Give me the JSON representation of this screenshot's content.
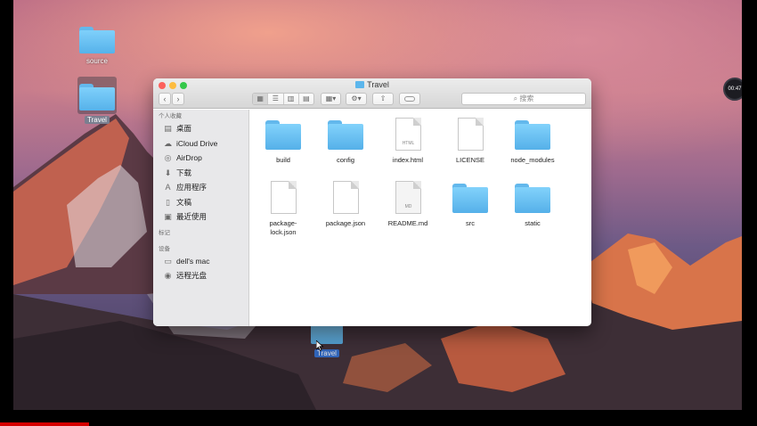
{
  "desktop": {
    "icons": [
      {
        "label": "source"
      },
      {
        "label": "Travel"
      }
    ],
    "dragging_label": "Travel",
    "timer": "00:47"
  },
  "window": {
    "title": "Travel",
    "toolbar": {
      "back": "‹",
      "forward": "›",
      "search_placeholder": "搜索"
    }
  },
  "sidebar": {
    "sections": [
      {
        "header": "个人收藏",
        "items": [
          {
            "label": "桌面",
            "icon": "desktop-icon"
          },
          {
            "label": "iCloud Drive",
            "icon": "cloud-icon"
          },
          {
            "label": "AirDrop",
            "icon": "airdrop-icon"
          },
          {
            "label": "下载",
            "icon": "download-icon"
          },
          {
            "label": "应用程序",
            "icon": "applications-icon"
          },
          {
            "label": "文稿",
            "icon": "documents-icon"
          },
          {
            "label": "最近使用",
            "icon": "recents-icon"
          }
        ]
      },
      {
        "header": "标记",
        "items": []
      },
      {
        "header": "设备",
        "items": [
          {
            "label": "dell's mac",
            "icon": "computer-icon"
          },
          {
            "label": "远程光盘",
            "icon": "disc-icon"
          }
        ]
      }
    ]
  },
  "files": [
    {
      "name": "build",
      "kind": "folder"
    },
    {
      "name": "config",
      "kind": "folder"
    },
    {
      "name": "index.html",
      "kind": "doc",
      "tag": "HTML"
    },
    {
      "name": "LICENSE",
      "kind": "doc",
      "tag": ""
    },
    {
      "name": "node_modules",
      "kind": "folder"
    },
    {
      "name": "package-lock.json",
      "kind": "doc",
      "tag": "",
      "display": [
        "package-",
        "lock.json"
      ]
    },
    {
      "name": "package.json",
      "kind": "doc",
      "tag": ""
    },
    {
      "name": "README.md",
      "kind": "doc",
      "tag": "MD"
    },
    {
      "name": "src",
      "kind": "folder"
    },
    {
      "name": "static",
      "kind": "folder"
    }
  ],
  "colors": {
    "folder": "#6ec3f5",
    "close": "#fc605c",
    "minimize": "#fdbc40",
    "maximize": "#34c84a"
  }
}
